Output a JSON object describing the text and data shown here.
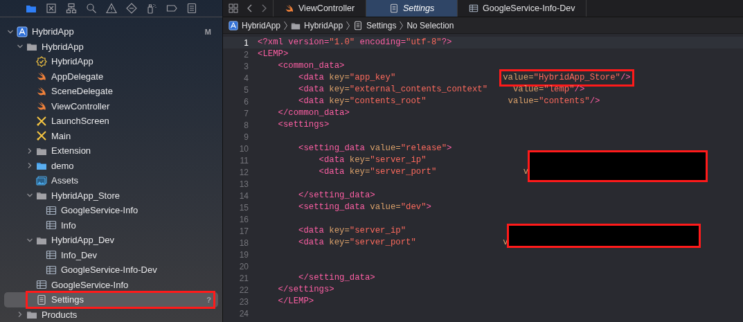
{
  "navigator_toolbar": [
    {
      "kind": "folder",
      "selected": true
    },
    {
      "kind": "xbox",
      "selected": false
    },
    {
      "kind": "hierarchy",
      "selected": false
    },
    {
      "kind": "search",
      "selected": false
    },
    {
      "kind": "warning",
      "selected": false
    },
    {
      "kind": "diamond",
      "selected": false
    },
    {
      "kind": "spray",
      "selected": false
    },
    {
      "kind": "tag",
      "selected": false
    },
    {
      "kind": "list",
      "selected": false
    }
  ],
  "tree": [
    {
      "label": "HybridApp",
      "kind": "project",
      "badge": "M",
      "expanded": true,
      "selected": false,
      "highlighted": false,
      "children": [
        {
          "label": "HybridApp",
          "kind": "folder",
          "expanded": true,
          "selected": false,
          "highlighted": false,
          "children": [
            {
              "label": "HybridApp",
              "kind": "entitlements",
              "selected": false,
              "highlighted": false
            },
            {
              "label": "AppDelegate",
              "kind": "swift",
              "selected": false,
              "highlighted": false
            },
            {
              "label": "SceneDelegate",
              "kind": "swift",
              "selected": false,
              "highlighted": false
            },
            {
              "label": "ViewController",
              "kind": "swift",
              "selected": false,
              "highlighted": false
            },
            {
              "label": "LaunchScreen",
              "kind": "storyboard",
              "selected": false,
              "highlighted": false
            },
            {
              "label": "Main",
              "kind": "storyboard",
              "selected": false,
              "highlighted": false
            },
            {
              "label": "Extension",
              "kind": "folder",
              "expanded": false,
              "selected": false,
              "highlighted": false
            },
            {
              "label": "demo",
              "kind": "reference-folder",
              "expanded": false,
              "selected": false,
              "highlighted": false
            },
            {
              "label": "Assets",
              "kind": "assets",
              "selected": false,
              "highlighted": false
            },
            {
              "label": "HybridApp_Store",
              "kind": "folder",
              "expanded": true,
              "selected": false,
              "highlighted": false,
              "children": [
                {
                  "label": "GoogleService-Info",
                  "kind": "plist",
                  "selected": false,
                  "highlighted": false
                },
                {
                  "label": "Info",
                  "kind": "plist",
                  "selected": false,
                  "highlighted": false
                }
              ]
            },
            {
              "label": "HybridApp_Dev",
              "kind": "folder",
              "expanded": true,
              "selected": false,
              "highlighted": false,
              "children": [
                {
                  "label": "Info_Dev",
                  "kind": "plist",
                  "selected": false,
                  "highlighted": false
                },
                {
                  "label": "GoogleService-Info-Dev",
                  "kind": "plist",
                  "selected": false,
                  "highlighted": false
                }
              ]
            },
            {
              "label": "GoogleService-Info",
              "kind": "plist",
              "selected": false,
              "highlighted": false
            },
            {
              "label": "Settings",
              "kind": "file",
              "badge": "?",
              "selected": true,
              "highlighted": true
            }
          ]
        },
        {
          "label": "Products",
          "kind": "folder",
          "expanded": false,
          "selected": false,
          "highlighted": false
        }
      ]
    }
  ],
  "tabs": [
    {
      "label": "ViewController",
      "kind": "swift",
      "selected": false
    },
    {
      "label": "Settings",
      "kind": "file",
      "selected": true
    },
    {
      "label": "GoogleService-Info-Dev",
      "kind": "plist",
      "selected": false
    }
  ],
  "breadcrumb": [
    {
      "label": "HybridApp",
      "kind": "project"
    },
    {
      "label": "HybridApp",
      "kind": "folder"
    },
    {
      "label": "Settings",
      "kind": "file"
    },
    {
      "label": "No Selection",
      "kind": "text"
    }
  ],
  "code_lines": [
    {
      "number": "1",
      "current": true,
      "redacted": false,
      "tokens": [
        {
          "kind": "tag",
          "text": "<?xml version="
        },
        {
          "kind": "string",
          "text": "\"1.0\""
        },
        {
          "kind": "tag",
          "text": " encoding="
        },
        {
          "kind": "string",
          "text": "\"utf-8\""
        },
        {
          "kind": "tag",
          "text": "?>"
        }
      ]
    },
    {
      "number": "2",
      "current": false,
      "redacted": false,
      "tokens": [
        {
          "kind": "tag",
          "text": "<LEMP>"
        }
      ]
    },
    {
      "number": "3",
      "current": false,
      "redacted": false,
      "tokens": [
        {
          "kind": "tag",
          "text": "    <common_data>"
        }
      ]
    },
    {
      "number": "4",
      "current": false,
      "redacted": false,
      "tokens": [
        {
          "kind": "tag",
          "text": "        <data "
        },
        {
          "kind": "attr",
          "text": "key="
        },
        {
          "kind": "string",
          "text": "\"app_key\"                     "
        }
      ],
      "boxed": [
        {
          "kind": "attr",
          "text": "value="
        },
        {
          "kind": "string",
          "text": "\"HybridApp_Store\""
        },
        {
          "kind": "tag",
          "text": "/>"
        }
      ]
    },
    {
      "number": "5",
      "current": false,
      "redacted": false,
      "tokens": [
        {
          "kind": "tag",
          "text": "        <data "
        },
        {
          "kind": "attr",
          "text": "key="
        },
        {
          "kind": "string",
          "text": "\"external_contents_context\"     "
        },
        {
          "kind": "attr",
          "text": "value="
        },
        {
          "kind": "string",
          "text": "\"lemp\""
        },
        {
          "kind": "tag",
          "text": "/>"
        }
      ]
    },
    {
      "number": "6",
      "current": false,
      "redacted": false,
      "tokens": [
        {
          "kind": "tag",
          "text": "        <data "
        },
        {
          "kind": "attr",
          "text": "key="
        },
        {
          "kind": "string",
          "text": "\"contents_root\"                "
        },
        {
          "kind": "attr",
          "text": "value="
        },
        {
          "kind": "string",
          "text": "\"contents\""
        },
        {
          "kind": "tag",
          "text": "/>"
        }
      ]
    },
    {
      "number": "7",
      "current": false,
      "redacted": false,
      "tokens": [
        {
          "kind": "tag",
          "text": "    </common_data>"
        }
      ]
    },
    {
      "number": "8",
      "current": false,
      "redacted": false,
      "tokens": [
        {
          "kind": "tag",
          "text": "    <settings>"
        }
      ]
    },
    {
      "number": "9",
      "current": false,
      "redacted": false
    },
    {
      "number": "10",
      "current": false,
      "redacted": false,
      "tokens": [
        {
          "kind": "tag",
          "text": "        <setting_data "
        },
        {
          "kind": "attr",
          "text": "value="
        },
        {
          "kind": "string",
          "text": "\"release\""
        },
        {
          "kind": "tag",
          "text": ">"
        }
      ]
    },
    {
      "number": "11",
      "current": false,
      "redacted": true,
      "tokens": [
        {
          "kind": "tag",
          "text": "            <data "
        },
        {
          "kind": "attr",
          "text": "key="
        },
        {
          "kind": "string",
          "text": "\"server_ip\""
        }
      ]
    },
    {
      "number": "12",
      "current": false,
      "redacted": true,
      "tokens": [
        {
          "kind": "tag",
          "text": "            <data "
        },
        {
          "kind": "attr",
          "text": "key="
        },
        {
          "kind": "string",
          "text": "\"server_port\"                 "
        },
        {
          "kind": "attr",
          "text": "v"
        }
      ]
    },
    {
      "number": "13",
      "current": false,
      "redacted": false
    },
    {
      "number": "14",
      "current": false,
      "redacted": false,
      "tokens": [
        {
          "kind": "tag",
          "text": "        </setting_data>"
        }
      ]
    },
    {
      "number": "15",
      "current": false,
      "redacted": false,
      "tokens": [
        {
          "kind": "tag",
          "text": "        <setting_data "
        },
        {
          "kind": "attr",
          "text": "value="
        },
        {
          "kind": "string",
          "text": "\"dev\""
        },
        {
          "kind": "tag",
          "text": ">"
        }
      ]
    },
    {
      "number": "16",
      "current": false,
      "redacted": false
    },
    {
      "number": "17",
      "current": false,
      "redacted": true,
      "tokens": [
        {
          "kind": "tag",
          "text": "        <data "
        },
        {
          "kind": "attr",
          "text": "key="
        },
        {
          "kind": "string",
          "text": "\"server_ip\""
        }
      ]
    },
    {
      "number": "18",
      "current": false,
      "redacted": true,
      "tokens": [
        {
          "kind": "tag",
          "text": "        <data "
        },
        {
          "kind": "attr",
          "text": "key="
        },
        {
          "kind": "string",
          "text": "\"server_port\"                 "
        },
        {
          "kind": "attr",
          "text": "v"
        }
      ]
    },
    {
      "number": "19",
      "current": false,
      "redacted": false
    },
    {
      "number": "20",
      "current": false,
      "redacted": false
    },
    {
      "number": "21",
      "current": false,
      "redacted": false,
      "tokens": [
        {
          "kind": "tag",
          "text": "        </setting_data>"
        }
      ]
    },
    {
      "number": "22",
      "current": false,
      "redacted": false,
      "tokens": [
        {
          "kind": "tag",
          "text": "    </settings>"
        }
      ]
    },
    {
      "number": "23",
      "current": false,
      "redacted": false,
      "tokens": [
        {
          "kind": "tag",
          "text": "    </LEMP>"
        }
      ]
    },
    {
      "number": "24",
      "current": false,
      "redacted": false
    }
  ]
}
